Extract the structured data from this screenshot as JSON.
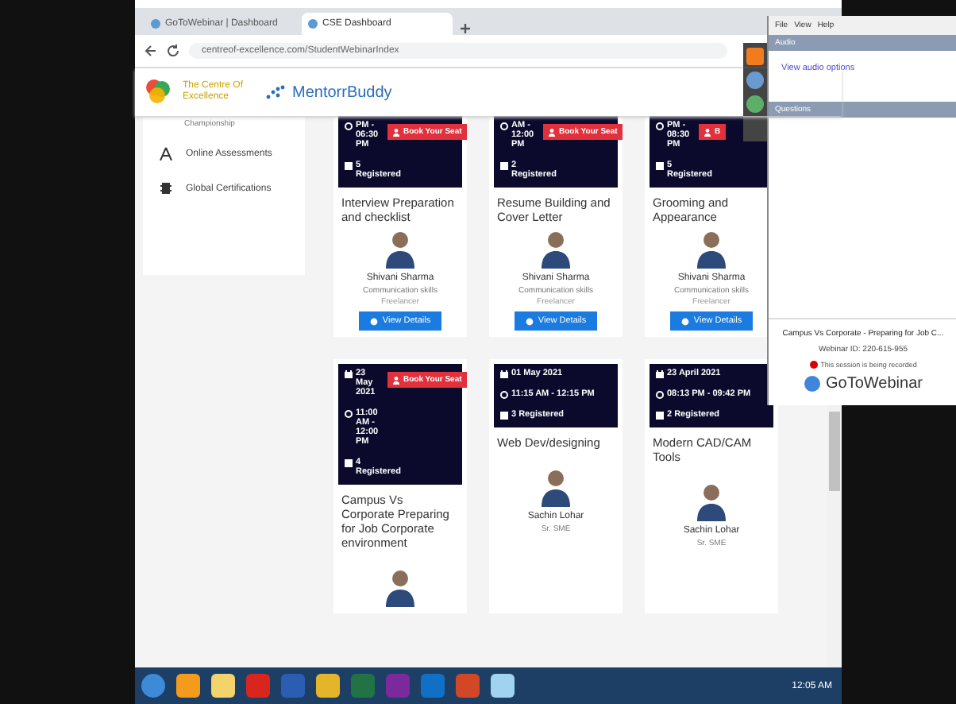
{
  "browser": {
    "tabs": [
      {
        "label": "GoToWebinar | Dashboard",
        "selected": false
      },
      {
        "label": "CSE Dashboard",
        "selected": true
      }
    ],
    "url": "centreof-excellence.com/StudentWebinarIndex"
  },
  "header": {
    "logo_text": "The Centre Of Excellence",
    "brand": "MentorrBuddy"
  },
  "sidebar": {
    "items": [
      {
        "label": "Championship",
        "kind": "cut"
      },
      {
        "label": "Online Assessments",
        "kind": "assessment"
      },
      {
        "label": "Global Certifications",
        "kind": "certificate"
      }
    ]
  },
  "rows": [
    {
      "cards": [
        {
          "time": "PM - 06:30 PM",
          "booking": "Book Your Seat",
          "registered": "5 Registered",
          "title": "Interview Preparation and checklist",
          "speaker": {
            "name": "Shivani Sharma",
            "role": "Communication skills",
            "org": "Freelancer"
          },
          "button": "View Details"
        },
        {
          "time": "AM - 12:00 PM",
          "booking": "Book Your Seat",
          "registered": "2 Registered",
          "title": "Resume Building and Cover Letter",
          "speaker": {
            "name": "Shivani Sharma",
            "role": "Communication skills",
            "org": "Freelancer"
          },
          "button": "View Details"
        },
        {
          "time": "PM - 08:30 PM",
          "booking": "B",
          "registered": "5 Registered",
          "title": "Grooming and Appearance",
          "speaker": {
            "name": "Shivani Sharma",
            "role": "Communication skills",
            "org": "Freelancer"
          },
          "button": "View Details"
        }
      ]
    },
    {
      "cards": [
        {
          "date": "23 May 2021",
          "time": "11:00 AM - 12:00 PM",
          "booking": "Book Your Seat",
          "registered": "4 Registered",
          "title": "Campus Vs Corporate Preparing for Job Corporate environment"
        },
        {
          "date": "01 May 2021",
          "time": "11:15 AM - 12:15 PM",
          "registered": "3 Registered",
          "title": "Web Dev/designing",
          "speaker": {
            "name": "Sachin Lohar",
            "role": "Sr. SME"
          }
        },
        {
          "date": "23 April 2021",
          "time": "08:13 PM - 09:42 PM",
          "registered": "2 Registered",
          "title": "Modern CAD/CAM Tools",
          "speaker": {
            "name": "Sachin Lohar",
            "role": "Sr. SME"
          }
        }
      ]
    }
  ],
  "webinar_panel": {
    "menu": [
      "File",
      "View",
      "Help"
    ],
    "sections": [
      {
        "title": "Audio",
        "link": "View audio options"
      },
      {
        "title": "Questions"
      }
    ],
    "session_title": "Campus Vs Corporate - Preparing for Job C...",
    "webinar_id": "Webinar ID: 220-615-955",
    "recording": "This session is being recorded",
    "logo": "GoToWebinar"
  },
  "taskbar": {
    "icons": [
      {
        "kind": "start"
      },
      {
        "kind": "media"
      },
      {
        "kind": "folder"
      },
      {
        "kind": "pdf"
      },
      {
        "kind": "word"
      },
      {
        "kind": "chrome"
      },
      {
        "kind": "excel"
      },
      {
        "kind": "onenote"
      },
      {
        "kind": "outlook"
      },
      {
        "kind": "powerpoint"
      },
      {
        "kind": "snowflake"
      }
    ],
    "clock": "12:05 AM"
  }
}
